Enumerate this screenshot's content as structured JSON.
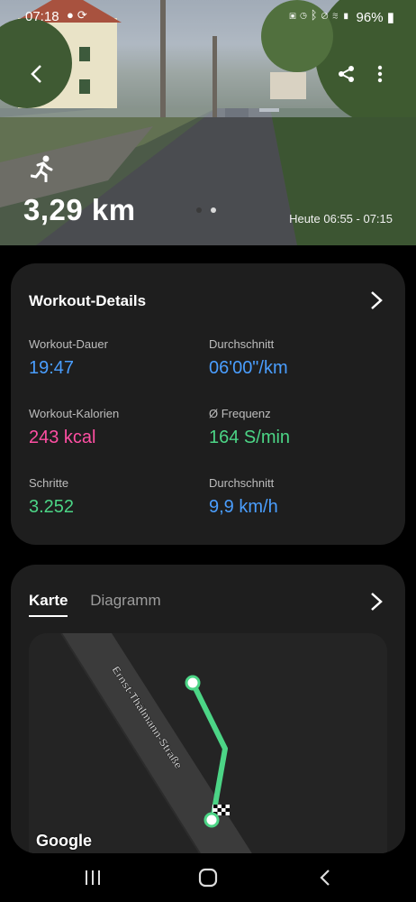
{
  "status_bar": {
    "time": "07:18",
    "left_icons": [
      "notification-icon",
      "sync-icon"
    ],
    "right_icons": [
      "media-icon",
      "alarm-icon",
      "bluetooth-icon",
      "mute-icon",
      "wifi-icon",
      "signal-icon"
    ],
    "battery": "96%"
  },
  "hero": {
    "distance": "3,29 km",
    "time_range": "Heute 06:55 - 07:15",
    "page_count": 2,
    "active_page": 1
  },
  "workout_details": {
    "title": "Workout-Details",
    "metrics": [
      {
        "label": "Workout-Dauer",
        "value": "19:47",
        "color": "#4a9eff"
      },
      {
        "label": "Durchschnitt",
        "value": "06'00\"/km",
        "color": "#4a9eff"
      },
      {
        "label": "Workout-Kalorien",
        "value": "243 kcal",
        "color": "#ff4fa3"
      },
      {
        "label": "Ø Frequenz",
        "value": "164 S/min",
        "color": "#4cd586"
      },
      {
        "label": "Schritte",
        "value": "3.252",
        "color": "#4cd586"
      },
      {
        "label": "Durchschnitt",
        "value": "9,9 km/h",
        "color": "#4a9eff"
      }
    ]
  },
  "map_card": {
    "tabs": [
      {
        "label": "Karte",
        "active": true
      },
      {
        "label": "Diagramm",
        "active": false
      }
    ],
    "street_name": "Ernst-Thälmann-Straße",
    "attribution": "Google",
    "route_color": "#4cd586"
  },
  "colors": {
    "background": "#000000",
    "card": "#1e1e1e",
    "blue": "#4a9eff",
    "pink": "#ff4fa3",
    "green": "#4cd586"
  }
}
